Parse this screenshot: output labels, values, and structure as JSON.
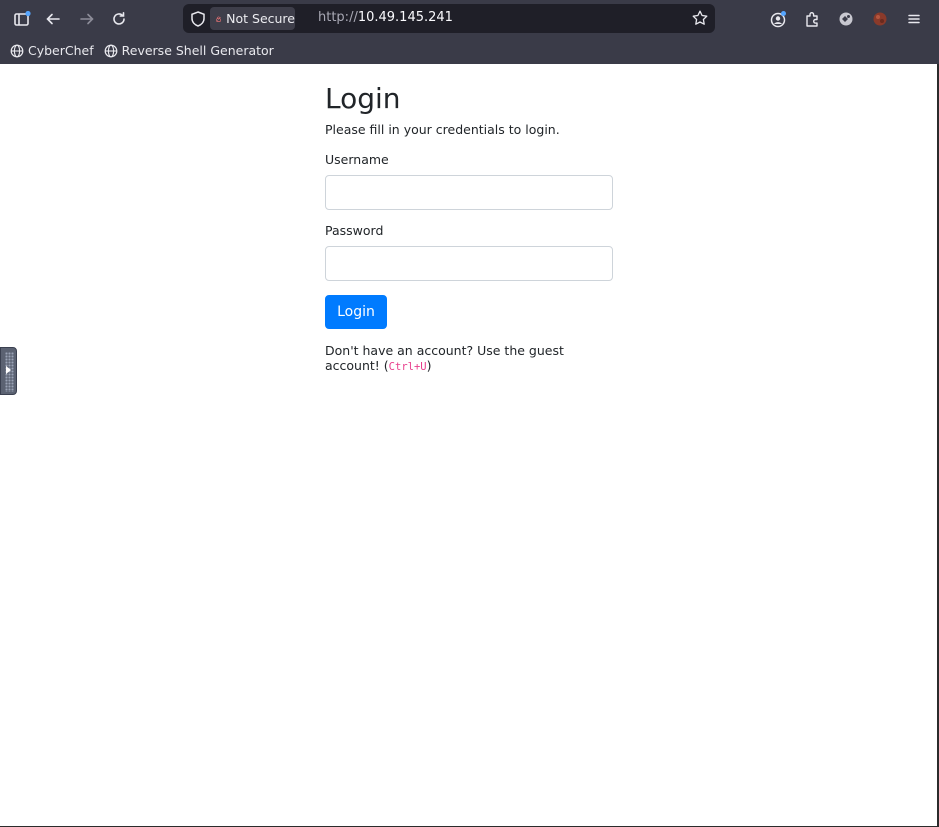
{
  "browser": {
    "security_label": "Not Secure",
    "url_protocol": "http://",
    "url_host": "10.49.145.241",
    "icons": [
      "sidebar-icon",
      "back-icon",
      "forward-icon",
      "reload-icon",
      "shield-icon",
      "lock-icon",
      "star-icon",
      "account-icon",
      "extensions-icon",
      "extension-icon",
      "profile-icon",
      "menu-icon"
    ]
  },
  "bookmarks": [
    {
      "label": "CyberChef"
    },
    {
      "label": "Reverse Shell Generator"
    }
  ],
  "page": {
    "title": "Login",
    "subtitle": "Please fill in your credentials to login.",
    "username_label": "Username",
    "username_value": "",
    "password_label": "Password",
    "password_value": "",
    "login_button": "Login",
    "note_text": "Don't have an account? Use the guest account! (",
    "note_shortcut": "Ctrl+U",
    "note_end": ")"
  },
  "colors": {
    "toolbar": "#3a3b48",
    "primary": "#007bff",
    "code": "#e83e8c"
  }
}
